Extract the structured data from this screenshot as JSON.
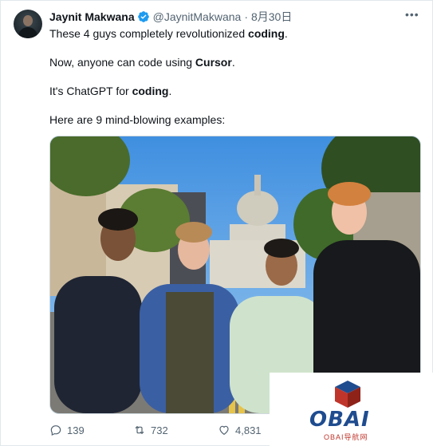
{
  "author": {
    "name": "Jaynit Makwana",
    "handle": "@JaynitMakwana",
    "date": "8月30日",
    "date_separator": "·"
  },
  "tweet": {
    "line1_prefix": "These 4 guys completely revolutionized ",
    "line1_bold": "coding",
    "line1_suffix": ".",
    "line2_prefix": "Now, anyone can code using ",
    "line2_bold": "Cursor",
    "line2_suffix": ".",
    "line3_prefix": "It's ChatGPT for ",
    "line3_bold": "coding",
    "line3_suffix": ".",
    "line4": "Here are 9 mind-blowing examples:"
  },
  "actions": {
    "replies": "139",
    "retweets": "732",
    "likes": "4,831"
  },
  "watermark": {
    "brand": "OBAI",
    "subtitle": "OBAI导航网"
  },
  "colors": {
    "verified": "#1d9bf0",
    "text": "#0f1419",
    "muted": "#536471",
    "watermark_blue": "#1f4c8f",
    "watermark_red": "#c0352b"
  }
}
